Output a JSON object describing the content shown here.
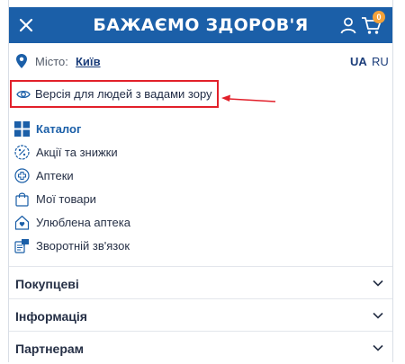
{
  "header": {
    "title": "БАЖАЄМО ЗДОРОВ'Я",
    "cart_count": "0",
    "background_color": "#1b5fa8",
    "icons": [
      "close-icon",
      "user-icon",
      "cart-icon"
    ]
  },
  "location": {
    "label": "Місто:",
    "city": "Київ",
    "languages": [
      "UA",
      "RU"
    ],
    "active_language": "UA"
  },
  "accessibility": {
    "label": "Версія для людей з вадами зору",
    "highlight_color": "#e2202a"
  },
  "menu": {
    "items": [
      {
        "label": "Каталог",
        "icon": "catalog-grid-icon",
        "emphasized": true
      },
      {
        "label": "Акції та знижки",
        "icon": "discount-icon"
      },
      {
        "label": "Аптеки",
        "icon": "pharmacy-cross-icon"
      },
      {
        "label": "Мої товари",
        "icon": "bag-icon"
      },
      {
        "label": "Улюблена аптека",
        "icon": "favorite-pharmacy-icon"
      },
      {
        "label": "Зворотній зв'язок",
        "icon": "feedback-icon"
      }
    ]
  },
  "accordion": {
    "sections": [
      {
        "label": "Покупцеві"
      },
      {
        "label": "Інформація"
      },
      {
        "label": "Партнерам"
      }
    ]
  }
}
